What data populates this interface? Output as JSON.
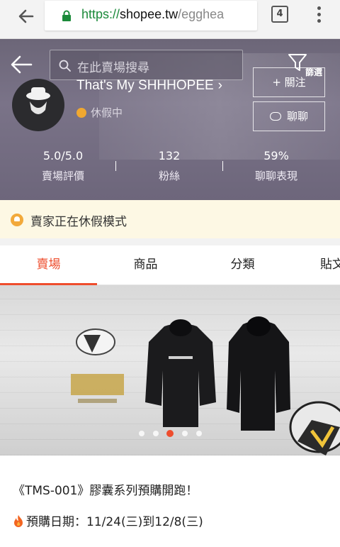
{
  "browser": {
    "url_scheme": "https://",
    "url_host": "shopee.tw",
    "url_path": "/egghea",
    "tab_count": "4"
  },
  "shop": {
    "search_placeholder": "在此賣場搜尋",
    "filter_label": "篩選",
    "name": "That's My SHHHOPEE",
    "status": "休假中",
    "follow_label": "+ 關注",
    "chat_label": "聊聊",
    "stats": [
      {
        "value": "5.0/5.0",
        "label": "賣場評價"
      },
      {
        "value": "132",
        "label": "粉絲"
      },
      {
        "value": "59%",
        "label": "聊聊表現"
      }
    ]
  },
  "vacation": {
    "text": "賣家正在休假模式"
  },
  "tabs": [
    {
      "label": "賣場",
      "active": true
    },
    {
      "label": "商品",
      "active": false
    },
    {
      "label": "分類",
      "active": false
    },
    {
      "label": "貼文",
      "active": false
    }
  ],
  "banner": {
    "slide_count": 5,
    "active_index": 2
  },
  "content": {
    "line1": "《TMS-001》膠囊系列預購開跑！",
    "line2": "預購日期：11/24(三)到12/8(三)"
  },
  "colors": {
    "accent": "#ee4d2d",
    "status_dot": "#f0a830",
    "url_green": "#1b8a3a"
  }
}
